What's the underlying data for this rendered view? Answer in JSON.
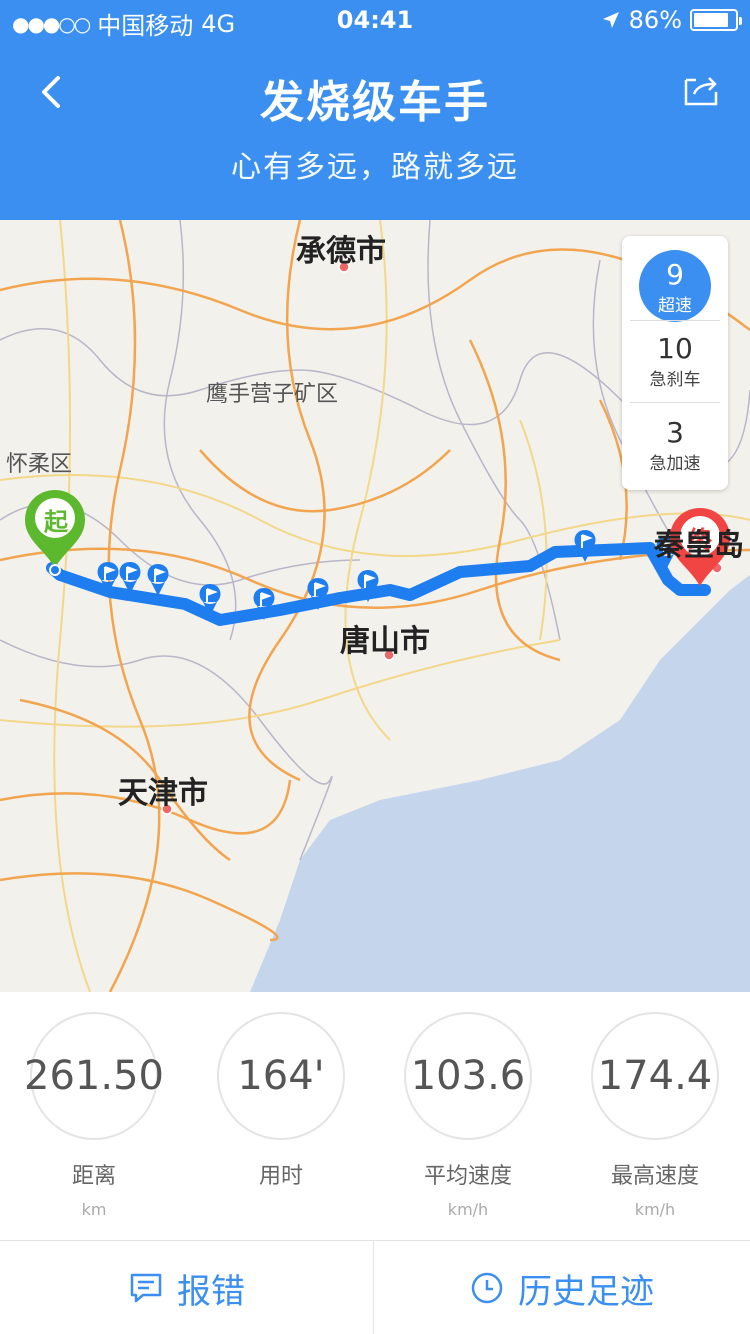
{
  "status": {
    "carrier": "中国移动",
    "network": "4G",
    "time": "04:41",
    "battery": "86%",
    "battery_level": 0.86
  },
  "header": {
    "title": "发烧级车手",
    "subtitle": "心有多远，路就多远"
  },
  "map": {
    "cities": [
      "承德市",
      "鹰手营子矿区",
      "怀柔区",
      "唐山市",
      "天津市",
      "秦皇岛"
    ],
    "start_label": "起",
    "end_label": "终",
    "colors": {
      "route": "#1e7ef0",
      "start": "#5cb82d",
      "end": "#f04542",
      "sea": "#c5d6ec"
    }
  },
  "events": [
    {
      "count": "9",
      "label": "超速"
    },
    {
      "count": "10",
      "label": "急刹车"
    },
    {
      "count": "3",
      "label": "急加速"
    }
  ],
  "stats": [
    {
      "value": "261.50",
      "label": "距离",
      "unit": "km"
    },
    {
      "value": "164'",
      "label": "用时",
      "unit": ""
    },
    {
      "value": "103.6",
      "label": "平均速度",
      "unit": "km/h"
    },
    {
      "value": "174.4",
      "label": "最高速度",
      "unit": "km/h"
    }
  ],
  "actions": {
    "report": "报错",
    "history": "历史足迹"
  }
}
